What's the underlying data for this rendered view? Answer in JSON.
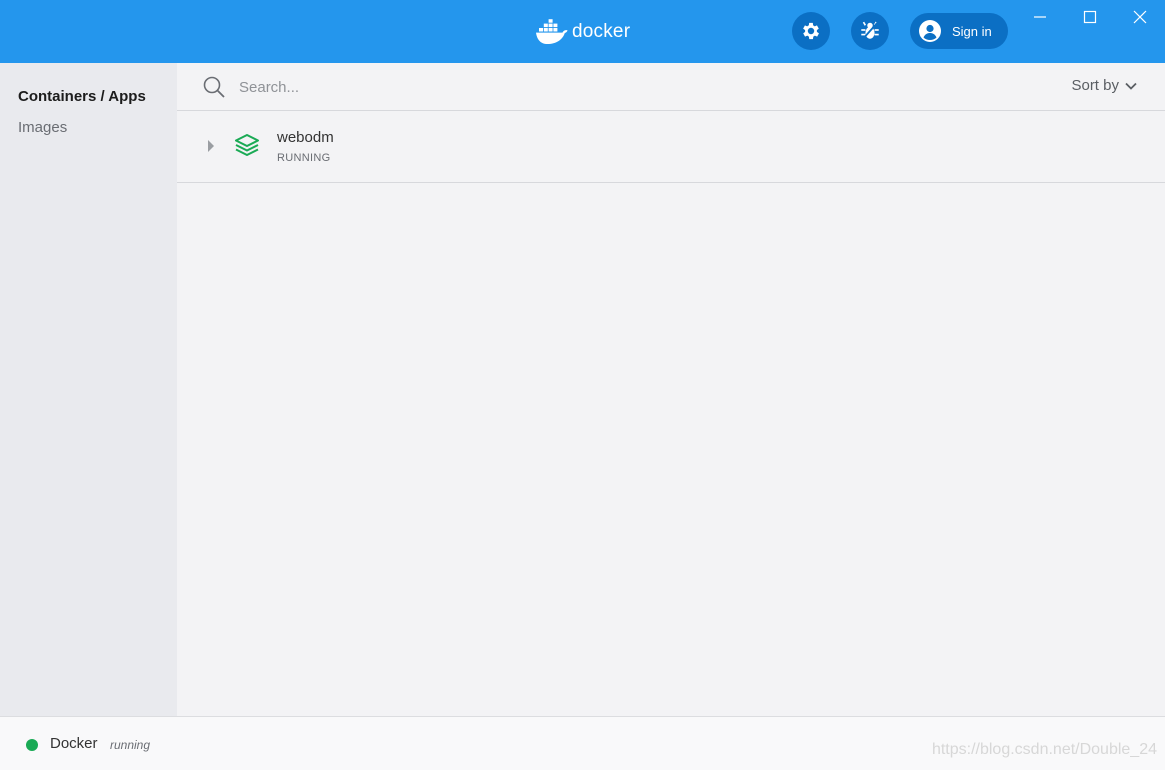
{
  "titlebar": {
    "logo_text": "docker",
    "brand_color": "#2496ed",
    "icons": [
      "settings-icon",
      "bug-icon",
      "user-icon"
    ],
    "signin_label": "Sign in"
  },
  "sidebar": {
    "items": [
      {
        "label": "Containers / Apps",
        "active": true
      },
      {
        "label": "Images",
        "active": false
      }
    ]
  },
  "search": {
    "placeholder": "Search...",
    "value": "",
    "sort_label": "Sort by"
  },
  "containers": [
    {
      "name": "webodm",
      "status": "RUNNING",
      "status_color": "#1aaa55"
    }
  ],
  "statusbar": {
    "app_name": "Docker",
    "state": "running",
    "state_color": "#1aaa55",
    "watermark": "https://blog.csdn.net/Double_24"
  }
}
